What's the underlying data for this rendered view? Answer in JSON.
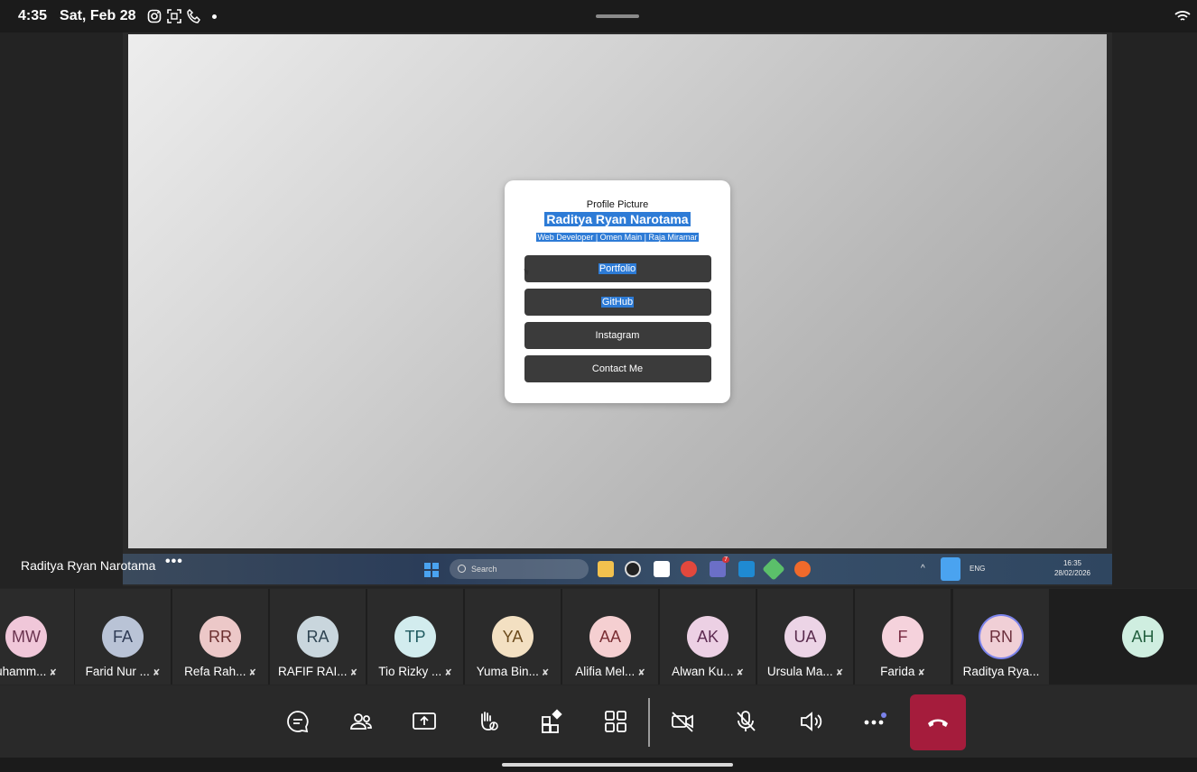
{
  "status_bar": {
    "time": "4:35",
    "date": "Sat, Feb 28",
    "icons": [
      "instagram-icon",
      "scan-icon",
      "phone-icon",
      "notification-dot",
      "wifi-icon"
    ]
  },
  "shared_screen": {
    "card": {
      "profile_picture_text": "Profile Picture",
      "name": "Raditya Ryan Narotama",
      "role": "Web Developer | Omen Main | Raja Miramar",
      "buttons": [
        {
          "label": "Portfolio",
          "highlighted": true
        },
        {
          "label": "GitHub",
          "highlighted": true
        },
        {
          "label": "Instagram",
          "highlighted": false
        },
        {
          "label": "Contact Me",
          "highlighted": false
        }
      ]
    },
    "taskbar": {
      "search_placeholder": "Search",
      "language": "ENG",
      "clock_time": "16:35",
      "clock_date": "28/02/2026",
      "teams_badge": "7"
    }
  },
  "presenter": {
    "name": "Raditya Ryan Narotama",
    "more_label": "•••"
  },
  "participants": [
    {
      "initials": "MW",
      "label": "uhamm...",
      "muted": true,
      "bg": "#f0c7d9",
      "fg": "#6b3450"
    },
    {
      "initials": "FA",
      "label": "Farid Nur ...",
      "muted": true,
      "bg": "#b9c3d6",
      "fg": "#2f3b55"
    },
    {
      "initials": "RR",
      "label": "Refa Rah...",
      "muted": true,
      "bg": "#ecc8c8",
      "fg": "#6b2f2f"
    },
    {
      "initials": "RA",
      "label": "RAFIF RAI...",
      "muted": true,
      "bg": "#c9d6dd",
      "fg": "#2f4452"
    },
    {
      "initials": "TP",
      "label": "Tio Rizky ...",
      "muted": true,
      "bg": "#d2ecee",
      "fg": "#1f5a5f"
    },
    {
      "initials": "YA",
      "label": "Yuma Bin...",
      "muted": true,
      "bg": "#f3e0c2",
      "fg": "#6b4a1c"
    },
    {
      "initials": "AA",
      "label": "Alifia Mel...",
      "muted": true,
      "bg": "#f5cfd1",
      "fg": "#7a2f34"
    },
    {
      "initials": "AK",
      "label": "Alwan Ku...",
      "muted": true,
      "bg": "#ecd0e4",
      "fg": "#5e2c52"
    },
    {
      "initials": "UA",
      "label": "Ursula Ma...",
      "muted": true,
      "bg": "#ecd4e6",
      "fg": "#5a2c4e"
    },
    {
      "initials": "F",
      "label": "Farida",
      "muted": true,
      "bg": "#f5d2dc",
      "fg": "#7a2f46"
    },
    {
      "initials": "RN",
      "label": "Raditya Rya...",
      "muted": false,
      "bg": "#f0cfd6",
      "fg": "#6b2f3c"
    },
    {
      "initials": "AH",
      "label": "",
      "muted": false,
      "bg": "#cfeee0",
      "fg": "#23603f"
    }
  ],
  "controls": {
    "icons": [
      "chat-icon",
      "people-icon",
      "share-screen-icon",
      "raise-hand-icon",
      "apps-icon",
      "view-icon",
      "camera-off-icon",
      "mic-off-icon",
      "speaker-icon",
      "more-icon",
      "hang-up-icon"
    ]
  }
}
